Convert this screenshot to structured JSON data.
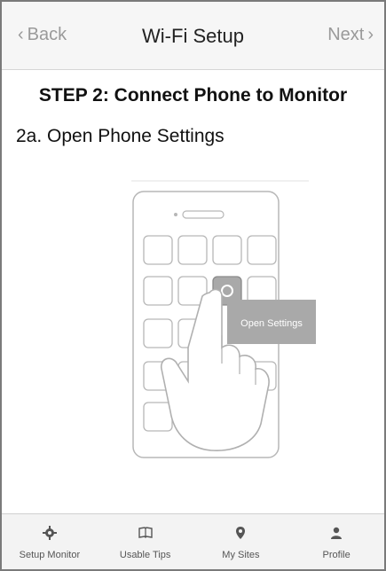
{
  "nav": {
    "back_label": "Back",
    "title": "Wi-Fi Setup",
    "next_label": "Next"
  },
  "content": {
    "step_title": "STEP 2: Connect Phone to  Monitor",
    "sub_title": "2a. Open Phone Settings",
    "illustration": {
      "callout_label": "Open Settings"
    }
  },
  "tabbar": {
    "items": [
      {
        "label": "Setup Monitor",
        "icon": "gear-icon"
      },
      {
        "label": "Usable Tips",
        "icon": "book-icon"
      },
      {
        "label": "My Sites",
        "icon": "location-pin-icon"
      },
      {
        "label": "Profile",
        "icon": "person-icon"
      }
    ]
  }
}
